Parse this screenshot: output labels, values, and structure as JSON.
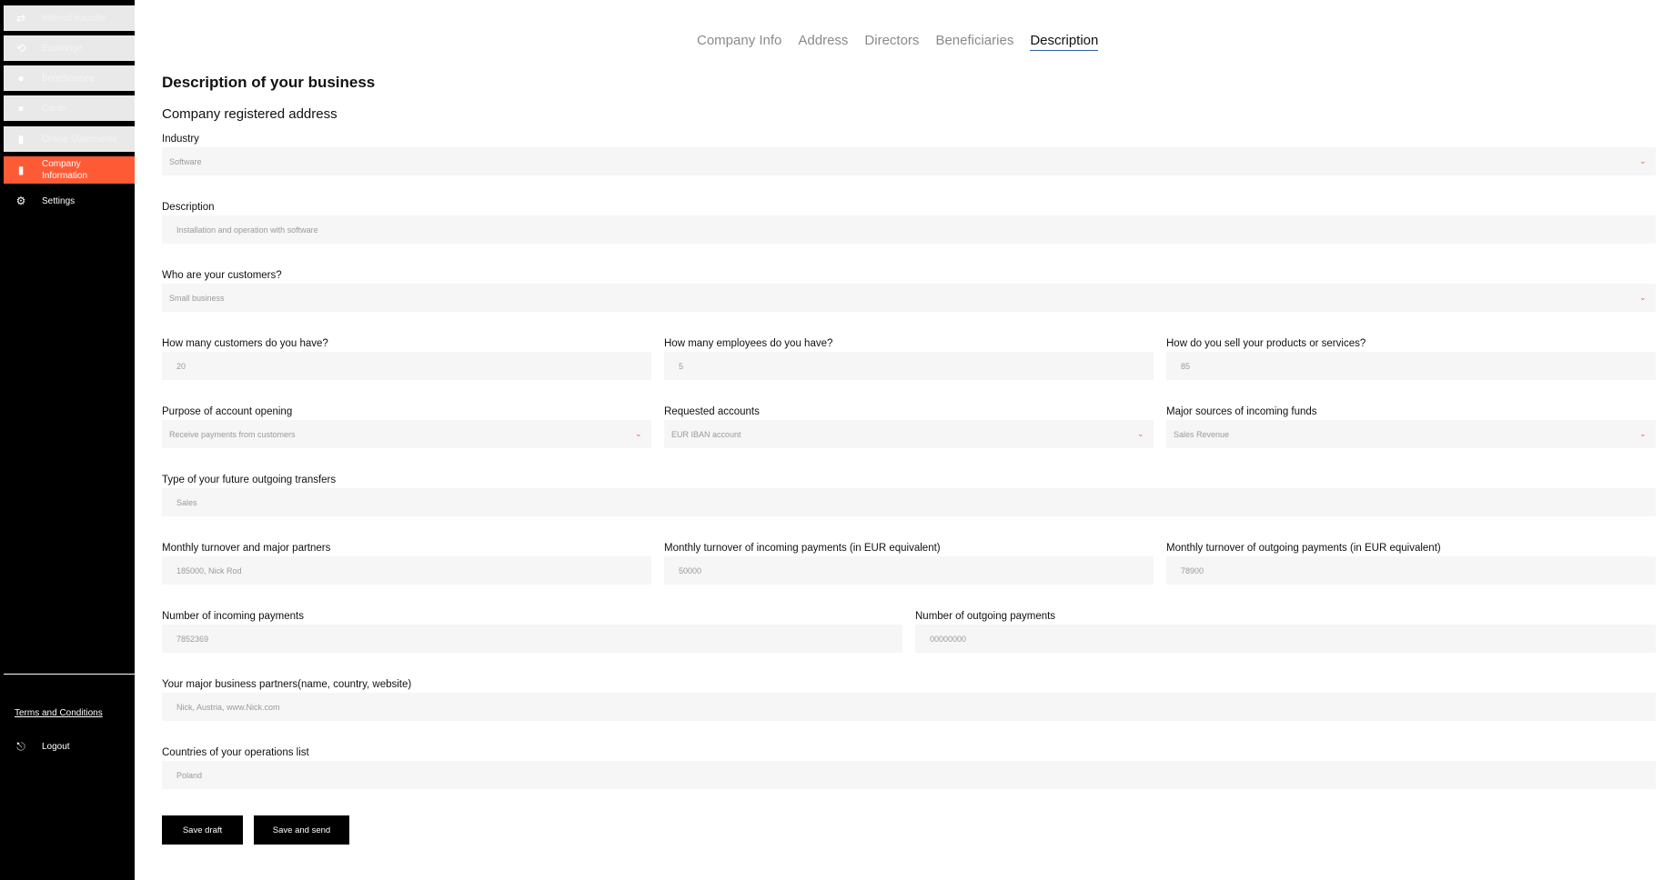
{
  "sidebar": {
    "items": [
      {
        "label": "Internal transfer",
        "icon": "transfer-icon"
      },
      {
        "label": "Exchange",
        "icon": "exchange-icon"
      },
      {
        "label": "Beneficiaries",
        "icon": "person-icon"
      },
      {
        "label": "Cards",
        "icon": "card-icon"
      },
      {
        "label": "Online Statements",
        "icon": "document-icon"
      },
      {
        "label": "Company Information",
        "icon": "building-icon"
      },
      {
        "label": "Settings",
        "icon": "gear-icon"
      }
    ],
    "terms": "Terms and Conditions",
    "logout": "Logout"
  },
  "tabs": [
    "Company Info",
    "Address",
    "Directors",
    "Beneficiaries",
    "Description"
  ],
  "page": {
    "title": "Description of your business",
    "subtitle": "Company registered address"
  },
  "fields": {
    "industry": {
      "label": "Industry",
      "value": "Software"
    },
    "description": {
      "label": "Description",
      "value": "Installation and operation with software"
    },
    "customers_type": {
      "label": "Who are your customers?",
      "value": "Small business"
    },
    "customers_count": {
      "label": "How many customers do you have?",
      "value": "20"
    },
    "employees": {
      "label": "How many employees do you have?",
      "value": "5"
    },
    "sell_method": {
      "label": "How do you sell your products or services?",
      "value": "85"
    },
    "purpose": {
      "label": "Purpose of account opening",
      "value": "Receive payments from customers"
    },
    "requested_accounts": {
      "label": "Requested accounts",
      "value": "EUR IBAN account"
    },
    "sources": {
      "label": "Major sources of incoming funds",
      "value": "Sales Revenue"
    },
    "transfer_type": {
      "label": "Type of your future outgoing transfers",
      "value": "Sales"
    },
    "turnover_partners": {
      "label": "Monthly turnover and major partners",
      "value": "185000, Nick Rod"
    },
    "turnover_in": {
      "label": "Monthly turnover of incoming payments (in EUR equivalent)",
      "value": "50000"
    },
    "turnover_out": {
      "label": "Monthly turnover of outgoing payments (in EUR equivalent)",
      "value": "78900"
    },
    "num_in": {
      "label": "Number of incoming payments",
      "value": "7852369"
    },
    "num_out": {
      "label": "Number of outgoing payments",
      "value": "00000000"
    },
    "partners": {
      "label": "Your major business partners(name, country, website)",
      "value": "Nick, Austria, www.Nick.com"
    },
    "countries": {
      "label": "Countries of your operations list",
      "value": "Poland"
    }
  },
  "buttons": {
    "save_draft": "Save draft",
    "save_send": "Save and send"
  },
  "colors": {
    "accent": "#ff5a36",
    "sidebar": "#000000",
    "field_bg": "#f6f6f6"
  }
}
